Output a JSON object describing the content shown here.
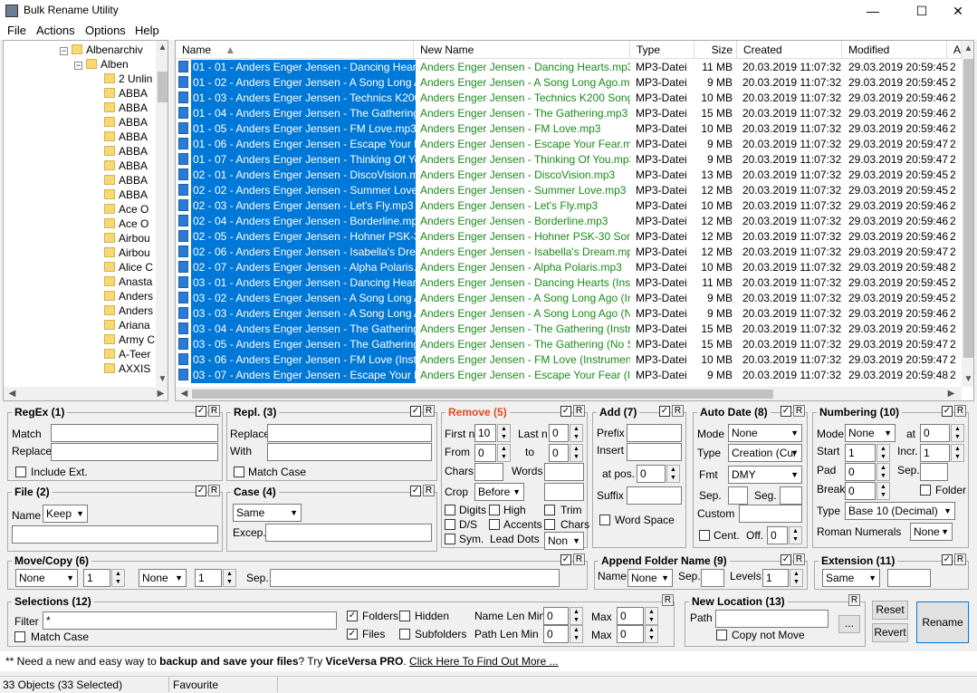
{
  "window": {
    "title": "Bulk Rename Utility",
    "minimize": "—",
    "maximize": "☐",
    "close": "✕"
  },
  "menu": [
    "File",
    "Actions",
    "Options",
    "Help"
  ],
  "tree": {
    "nodes": [
      {
        "label": "Albenarchiv",
        "expander": "−"
      },
      {
        "label": "Alben",
        "expander": "−"
      },
      {
        "label": "2 Unlin"
      },
      {
        "label": "ABBA"
      },
      {
        "label": "ABBA"
      },
      {
        "label": "ABBA"
      },
      {
        "label": "ABBA"
      },
      {
        "label": "ABBA"
      },
      {
        "label": "ABBA"
      },
      {
        "label": "ABBA"
      },
      {
        "label": "ABBA"
      },
      {
        "label": "Ace O"
      },
      {
        "label": "Ace O"
      },
      {
        "label": "Airbou"
      },
      {
        "label": "Airbou"
      },
      {
        "label": "Alice C"
      },
      {
        "label": "Anasta"
      },
      {
        "label": "Anders"
      },
      {
        "label": "Anders"
      },
      {
        "label": "Ariana"
      },
      {
        "label": "Army C"
      },
      {
        "label": "A-Teer"
      },
      {
        "label": "AXXIS"
      }
    ]
  },
  "list": {
    "headers": {
      "name": "Name",
      "sort_indicator": "▲",
      "new_name": "New Name",
      "type": "Type",
      "size": "Size",
      "created": "Created",
      "modified": "Modified",
      "more": "A"
    },
    "rows": [
      {
        "name": "01 - 01 - Anders Enger Jensen - Dancing Hearts....",
        "new": "Anders Enger Jensen - Dancing Hearts.mp3",
        "type": "MP3-Datei",
        "size": "11 MB",
        "created": "20.03.2019 11:07:32",
        "modified": "29.03.2019 20:59:45",
        "more": "2"
      },
      {
        "name": "01 - 02 - Anders Enger Jensen - A Song Long Ag...",
        "new": "Anders Enger Jensen - A Song Long Ago.mp3",
        "type": "MP3-Datei",
        "size": "9 MB",
        "created": "20.03.2019 11:07:32",
        "modified": "29.03.2019 20:59:45",
        "more": "2"
      },
      {
        "name": "01 - 03 - Anders Enger Jensen - Technics K200 ...",
        "new": "Anders Enger Jensen - Technics K200 Song....",
        "type": "MP3-Datei",
        "size": "10 MB",
        "created": "20.03.2019 11:07:32",
        "modified": "29.03.2019 20:59:46",
        "more": "2"
      },
      {
        "name": "01 - 04 - Anders Enger Jensen - The Gathering.m...",
        "new": "Anders Enger Jensen - The Gathering.mp3",
        "type": "MP3-Datei",
        "size": "15 MB",
        "created": "20.03.2019 11:07:32",
        "modified": "29.03.2019 20:59:46",
        "more": "2"
      },
      {
        "name": "01 - 05 - Anders Enger Jensen - FM Love.mp3",
        "new": "Anders Enger Jensen - FM Love.mp3",
        "type": "MP3-Datei",
        "size": "10 MB",
        "created": "20.03.2019 11:07:32",
        "modified": "29.03.2019 20:59:46",
        "more": "2"
      },
      {
        "name": "01 - 06 - Anders Enger Jensen - Escape Your Fe...",
        "new": "Anders Enger Jensen - Escape Your Fear.mp3",
        "type": "MP3-Datei",
        "size": "9 MB",
        "created": "20.03.2019 11:07:32",
        "modified": "29.03.2019 20:59:47",
        "more": "2"
      },
      {
        "name": "01 - 07 - Anders Enger Jensen - Thinking Of You...",
        "new": "Anders Enger Jensen - Thinking Of You.mp3",
        "type": "MP3-Datei",
        "size": "9 MB",
        "created": "20.03.2019 11:07:32",
        "modified": "29.03.2019 20:59:47",
        "more": "2"
      },
      {
        "name": "02 - 01 - Anders Enger Jensen - DiscoVision.mp3",
        "new": "Anders Enger Jensen - DiscoVision.mp3",
        "type": "MP3-Datei",
        "size": "13 MB",
        "created": "20.03.2019 11:07:32",
        "modified": "29.03.2019 20:59:45",
        "more": "2"
      },
      {
        "name": "02 - 02 - Anders Enger Jensen - Summer Love.mp3",
        "new": "Anders Enger Jensen - Summer Love.mp3",
        "type": "MP3-Datei",
        "size": "12 MB",
        "created": "20.03.2019 11:07:32",
        "modified": "29.03.2019 20:59:45",
        "more": "2"
      },
      {
        "name": "02 - 03 - Anders Enger Jensen - Let's Fly.mp3",
        "new": "Anders Enger Jensen - Let's Fly.mp3",
        "type": "MP3-Datei",
        "size": "10 MB",
        "created": "20.03.2019 11:07:32",
        "modified": "29.03.2019 20:59:46",
        "more": "2"
      },
      {
        "name": "02 - 04 - Anders Enger Jensen - Borderline.mp3",
        "new": "Anders Enger Jensen - Borderline.mp3",
        "type": "MP3-Datei",
        "size": "12 MB",
        "created": "20.03.2019 11:07:32",
        "modified": "29.03.2019 20:59:46",
        "more": "2"
      },
      {
        "name": "02 - 05 - Anders Enger Jensen - Hohner PSK-30 ...",
        "new": "Anders Enger Jensen - Hohner PSK-30 Song....",
        "type": "MP3-Datei",
        "size": "12 MB",
        "created": "20.03.2019 11:07:32",
        "modified": "29.03.2019 20:59:46",
        "more": "2"
      },
      {
        "name": "02 - 06 - Anders Enger Jensen - Isabella's Dream....",
        "new": "Anders Enger Jensen - Isabella's Dream.mp3",
        "type": "MP3-Datei",
        "size": "12 MB",
        "created": "20.03.2019 11:07:32",
        "modified": "29.03.2019 20:59:47",
        "more": "2"
      },
      {
        "name": "02 - 07 - Anders Enger Jensen - Alpha Polaris.mp3",
        "new": "Anders Enger Jensen - Alpha Polaris.mp3",
        "type": "MP3-Datei",
        "size": "10 MB",
        "created": "20.03.2019 11:07:32",
        "modified": "29.03.2019 20:59:48",
        "more": "2"
      },
      {
        "name": "03 - 01 - Anders Enger Jensen - Dancing Hearts (...",
        "new": "Anders Enger Jensen - Dancing Hearts (Instru...",
        "type": "MP3-Datei",
        "size": "11 MB",
        "created": "20.03.2019 11:07:32",
        "modified": "29.03.2019 20:59:45",
        "more": "2"
      },
      {
        "name": "03 - 02 - Anders Enger Jensen - A Song Long Ag...",
        "new": "Anders Enger Jensen - A Song Long Ago (Inst...",
        "type": "MP3-Datei",
        "size": "9 MB",
        "created": "20.03.2019 11:07:32",
        "modified": "29.03.2019 20:59:45",
        "more": "2"
      },
      {
        "name": "03 - 03 - Anders Enger Jensen - A Song Long Ag...",
        "new": "Anders Enger Jensen - A Song Long Ago (No ...",
        "type": "MP3-Datei",
        "size": "9 MB",
        "created": "20.03.2019 11:07:32",
        "modified": "29.03.2019 20:59:46",
        "more": "2"
      },
      {
        "name": "03 - 04 - Anders Enger Jensen - The Gathering (I...",
        "new": "Anders Enger Jensen - The Gathering (Instru...",
        "type": "MP3-Datei",
        "size": "15 MB",
        "created": "20.03.2019 11:07:32",
        "modified": "29.03.2019 20:59:46",
        "more": "2"
      },
      {
        "name": "03 - 05 - Anders Enger Jensen - The Gathering (I...",
        "new": "Anders Enger Jensen - The Gathering (No Sa...",
        "type": "MP3-Datei",
        "size": "15 MB",
        "created": "20.03.2019 11:07:32",
        "modified": "29.03.2019 20:59:47",
        "more": "2"
      },
      {
        "name": "03 - 06 - Anders Enger Jensen - FM Love (Instru...",
        "new": "Anders Enger Jensen - FM Love (Instrumental....",
        "type": "MP3-Datei",
        "size": "10 MB",
        "created": "20.03.2019 11:07:32",
        "modified": "29.03.2019 20:59:47",
        "more": "2"
      },
      {
        "name": "03 - 07 - Anders Enger Jensen - Escape Your Fe...",
        "new": "Anders Enger Jensen - Escape Your Fear (Ins...",
        "type": "MP3-Datei",
        "size": "9 MB",
        "created": "20.03.2019 11:07:32",
        "modified": "29.03.2019 20:59:48",
        "more": "2"
      }
    ]
  },
  "regex": {
    "title": "RegEx (1)",
    "match_label": "Match",
    "replace_label": "Replace",
    "include_ext": "Include Ext."
  },
  "repl": {
    "title": "Repl. (3)",
    "replace_label": "Replace",
    "with_label": "With",
    "match_case": "Match Case"
  },
  "remove": {
    "title": "Remove (5)",
    "first_n_label": "First n",
    "first_n": "10",
    "last_n_label": "Last n",
    "last_n": "0",
    "from_label": "From",
    "from": "0",
    "to_label": "to",
    "to": "0",
    "chars_label": "Chars",
    "words_label": "Words",
    "crop_label": "Crop",
    "crop": "Before",
    "digits": "Digits",
    "high": "High",
    "trim": "Trim",
    "ds": "D/S",
    "accents": "Accents",
    "chars": "Chars",
    "sym": "Sym.",
    "lead_dots": "Lead Dots",
    "lead_dots_value": "Non"
  },
  "add": {
    "title": "Add (7)",
    "prefix": "Prefix",
    "insert": "Insert",
    "at_pos": "at pos.",
    "at_pos_value": "0",
    "suffix": "Suffix",
    "word_space": "Word Space"
  },
  "autodate": {
    "title": "Auto Date (8)",
    "mode_label": "Mode",
    "mode": "None",
    "type_label": "Type",
    "type": "Creation (Cur",
    "fmt_label": "Fmt",
    "fmt": "DMY",
    "sep_label": "Sep.",
    "seg_label": "Seg.",
    "custom_label": "Custom",
    "cent": "Cent.",
    "off_label": "Off.",
    "off": "0"
  },
  "numbering": {
    "title": "Numbering (10)",
    "mode_label": "Mode",
    "mode": "None",
    "at_label": "at",
    "at": "0",
    "start_label": "Start",
    "start": "1",
    "incr_label": "Incr.",
    "incr": "1",
    "pad_label": "Pad",
    "pad": "0",
    "sep_label": "Sep.",
    "break_label": "Break",
    "break": "0",
    "folder": "Folder",
    "type_label": "Type",
    "type": "Base 10 (Decimal)",
    "roman_label": "Roman Numerals",
    "roman": "None"
  },
  "file": {
    "title": "File (2)",
    "name_label": "Name",
    "name": "Keep"
  },
  "case": {
    "title": "Case (4)",
    "case": "Same",
    "excep_label": "Excep."
  },
  "movecopy": {
    "title": "Move/Copy (6)",
    "mode1": "None",
    "n1": "1",
    "mode2": "None",
    "n2": "1",
    "sep_label": "Sep."
  },
  "appendfolder": {
    "title": "Append Folder Name (9)",
    "name_label": "Name",
    "name": "None",
    "sep_label": "Sep.",
    "levels_label": "Levels",
    "levels": "1"
  },
  "extension": {
    "title": "Extension (11)",
    "mode": "Same"
  },
  "selections": {
    "title": "Selections (12)",
    "filter_label": "Filter",
    "filter": "*",
    "match_case": "Match Case",
    "folders": "Folders",
    "hidden": "Hidden",
    "files": "Files",
    "subfolders": "Subfolders",
    "name_len_min": "Name Len Min",
    "name_len_min_val": "0",
    "path_len_min": "Path Len Min",
    "path_len_min_val": "0",
    "max_label": "Max",
    "max1": "0",
    "max2": "0"
  },
  "newlocation": {
    "title": "New Location (13)",
    "path_label": "Path",
    "browse": "...",
    "copy_not_move": "Copy not Move"
  },
  "buttons": {
    "reset": "Reset",
    "revert": "Revert",
    "rename": "Rename",
    "reset_marker": "R"
  },
  "promo": {
    "prefix": "** Need a new and easy way to ",
    "bold1": "backup and save your files",
    "middle": "? Try ",
    "bold2": "ViceVersa PRO",
    "after": ". ",
    "link": "Click Here To Find Out More ..."
  },
  "status": {
    "objects": "33 Objects (33 Selected)",
    "favourite": "Favourite"
  },
  "colors": {
    "selection": "#0078d7",
    "new_name": "#1a8b1a",
    "remove_title": "#e8491d"
  }
}
